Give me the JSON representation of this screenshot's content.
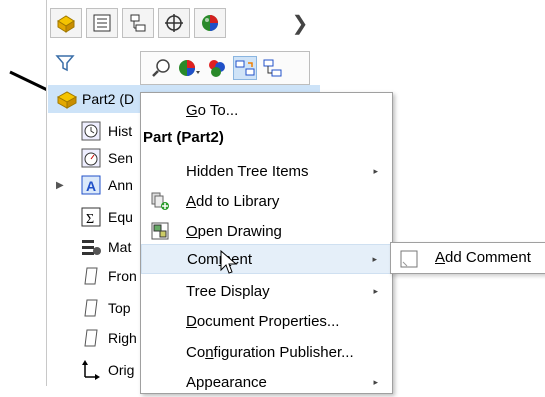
{
  "tree": {
    "root_label": "Part2  (D",
    "items": [
      {
        "label": "Hist",
        "icon": "history-icon"
      },
      {
        "label": "Sen",
        "icon": "sensors-icon"
      },
      {
        "label": "Ann",
        "icon": "annotations-icon"
      },
      {
        "label": "Equ",
        "icon": "equations-icon"
      },
      {
        "label": "Mat",
        "icon": "material-icon"
      },
      {
        "label": "Fron",
        "icon": "front-plane-icon"
      },
      {
        "label": "Top",
        "icon": "top-plane-icon"
      },
      {
        "label": "Righ",
        "icon": "right-plane-icon"
      },
      {
        "label": "Orig",
        "icon": "origin-icon"
      }
    ]
  },
  "context_menu": {
    "header": "Part (Part2)",
    "items": [
      {
        "pre": "",
        "ul": "G",
        "post": "o To...",
        "has_submenu": false,
        "icon": ""
      },
      {
        "pre": "",
        "ul": "",
        "post": "Hidden Tree Items",
        "has_submenu": true,
        "icon": ""
      },
      {
        "pre": "",
        "ul": "A",
        "post": "dd to Library",
        "has_submenu": false,
        "icon": "add-to-library-icon"
      },
      {
        "pre": "",
        "ul": "O",
        "post": "pen Drawing",
        "has_submenu": false,
        "icon": "open-drawing-icon"
      },
      {
        "pre": "Com",
        "ul": "m",
        "post": "ent",
        "has_submenu": true,
        "icon": ""
      },
      {
        "pre": "",
        "ul": "",
        "post": "Tree Display",
        "has_submenu": true,
        "icon": ""
      },
      {
        "pre": "",
        "ul": "D",
        "post": "ocument Properties...",
        "has_submenu": false,
        "icon": ""
      },
      {
        "pre": "Co",
        "ul": "n",
        "post": "figuration Publisher...",
        "has_submenu": false,
        "icon": ""
      },
      {
        "pre": "",
        "ul": "",
        "post": "Appearance",
        "has_submenu": true,
        "icon": ""
      }
    ]
  },
  "submenu": {
    "pre": "",
    "ul": "A",
    "post": "dd Comment",
    "icon": "comment-icon"
  },
  "colors": {
    "selection": "#cde3f8",
    "hover": "#e5eff9",
    "part_yellow": "#f5c400"
  }
}
